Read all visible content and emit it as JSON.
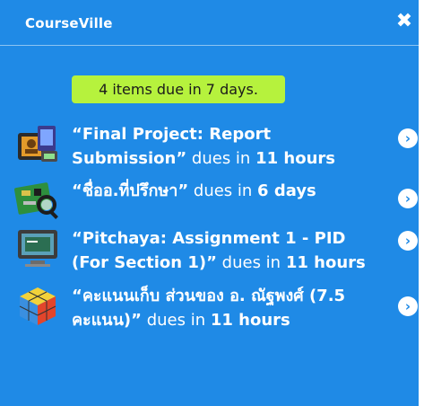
{
  "app": {
    "logo_text": "CourseVille",
    "close_glyph": "✖"
  },
  "summary": {
    "text": "4 items due in 7 days."
  },
  "items": [
    {
      "title": "“Final Project: Report Submission”",
      "suffix": " dues in ",
      "due": "11 hours",
      "icon": "project-icon"
    },
    {
      "title": "“ชื่ออ.ที่ปรึกษา”",
      "suffix": " dues in ",
      "due": "6 days",
      "icon": "circuit-search-icon"
    },
    {
      "title": "“Pitchaya: Assignment 1 - PID (For Section 1)”",
      "suffix": " dues in ",
      "due": "11 hours",
      "icon": "monitor-icon"
    },
    {
      "title": "“คะแนนเก็บ ส่วนของ อ. ณัฐพงศ์ (7.5 คะแนน)”",
      "suffix": " dues in ",
      "due": "11 hours",
      "icon": "cube-icon"
    }
  ],
  "colors": {
    "panel": "#1f8ae6",
    "badge": "#b6f23d"
  }
}
